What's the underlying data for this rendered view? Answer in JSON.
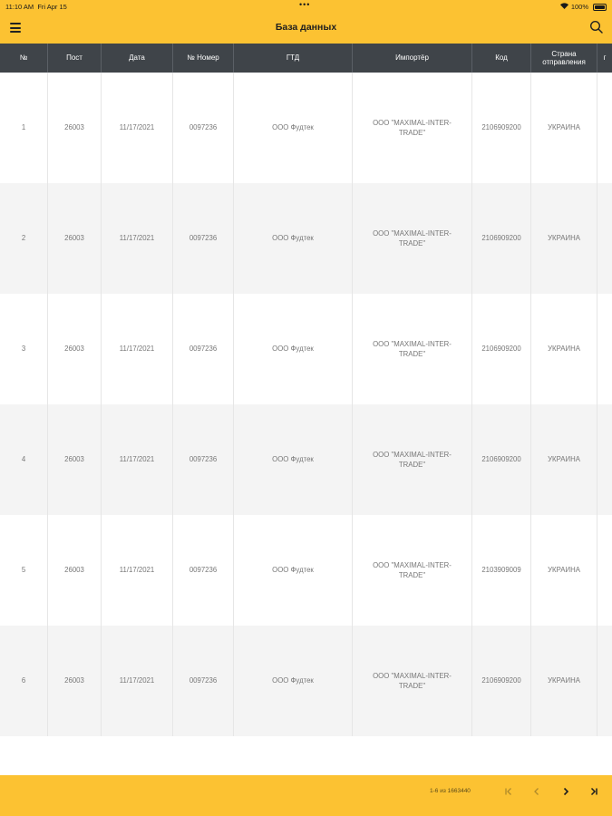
{
  "status_bar": {
    "time": "11:10 AM",
    "date": "Fri Apr 15",
    "battery": "100%"
  },
  "header": {
    "title": "База данных"
  },
  "table": {
    "columns": [
      "№",
      "Пост",
      "Дата",
      "№ Номер",
      "ГТД",
      "Импортёр",
      "Код",
      "Страна\nотправления",
      "г"
    ],
    "rows": [
      [
        "1",
        "26003",
        "11/17/2021",
        "0097236",
        "ООО Фудтек",
        "ООО \"MAXIMAL-INTER-\nTRADE\"",
        "2106909200",
        "УКРАИНА"
      ],
      [
        "2",
        "26003",
        "11/17/2021",
        "0097236",
        "ООО Фудтек",
        "ООО \"MAXIMAL-INTER-\nTRADE\"",
        "2106909200",
        "УКРАИНА"
      ],
      [
        "3",
        "26003",
        "11/17/2021",
        "0097236",
        "ООО Фудтек",
        "ООО \"MAXIMAL-INTER-\nTRADE\"",
        "2106909200",
        "УКРАИНА"
      ],
      [
        "4",
        "26003",
        "11/17/2021",
        "0097236",
        "ООО Фудтек",
        "ООО \"MAXIMAL-INTER-\nTRADE\"",
        "2106909200",
        "УКРАИНА"
      ],
      [
        "5",
        "26003",
        "11/17/2021",
        "0097236",
        "ООО Фудтек",
        "ООО \"MAXIMAL-INTER-\nTRADE\"",
        "2103909009",
        "УКРАИНА"
      ],
      [
        "6",
        "26003",
        "11/17/2021",
        "0097236",
        "ООО Фудтек",
        "ООО \"MAXIMAL-INTER-\nTRADE\"",
        "2106909200",
        "УКРАИНА"
      ]
    ]
  },
  "footer": {
    "page_info": "1-6 из 1663440"
  },
  "colors": {
    "accent": "#FCC232",
    "table_header": "#3f4449"
  }
}
